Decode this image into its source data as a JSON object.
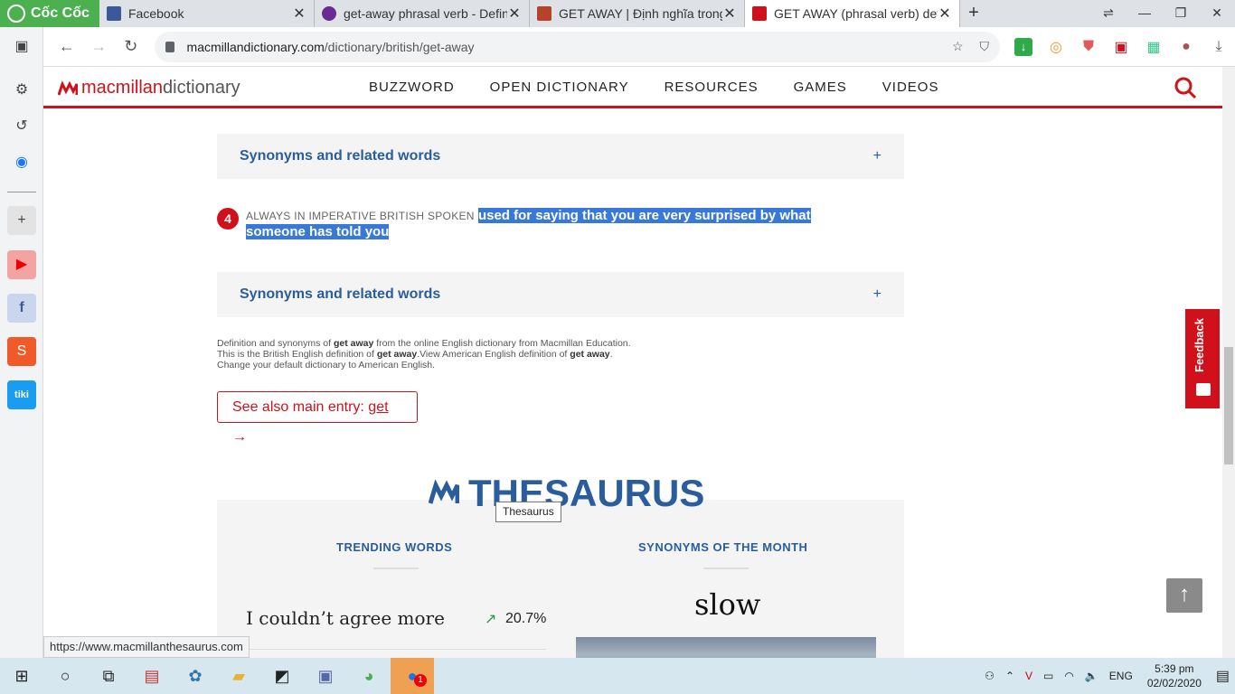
{
  "browser": {
    "brand": "Cốc Cốc",
    "tabs": [
      {
        "title": "Facebook",
        "color": "#3b5998"
      },
      {
        "title": "get-away phrasal verb - Defin",
        "color": "#6a2c91"
      },
      {
        "title": "GET AWAY | Định nghĩa trong",
        "color": "#b5432b"
      },
      {
        "title": "GET AWAY (phrasal verb) defi",
        "color": "#d0111c",
        "active": true
      }
    ],
    "url_host": "macmillandictionary.com",
    "url_path": "/dictionary/british/get-away",
    "status_url": "https://www.macmillanthesaurus.com"
  },
  "site": {
    "logo_brand": "macmillan",
    "logo_dict": "dictionary",
    "nav": [
      "BUZZWORD",
      "OPEN DICTIONARY",
      "RESOURCES",
      "GAMES",
      "VIDEOS"
    ]
  },
  "entry": {
    "synonyms_label": "Synonyms and related words",
    "expand_symbol": "+",
    "sense_number": "4",
    "sense_labels": "ALWAYS IN IMPERATIVE BRITISH SPOKEN",
    "sense_definition": "used for saying that you are very surprised by what someone has told you",
    "credit_line1_a": "Definition and synonyms of ",
    "credit_word": "get away",
    "credit_line1_b": " from the online English dictionary from Macmillan Education.",
    "credit_line2_a": "This is the British English definition of ",
    "credit_line2_b": ".View American English definition of ",
    "credit_line3": "Change your default dictionary to American English.",
    "see_also_prefix": "See also main entry: ",
    "see_also_word": "get",
    "see_also_arrow": "→"
  },
  "thesaurus": {
    "title": "THESAURUS",
    "tooltip": "Thesaurus",
    "trending_heading": "TRENDING WORDS",
    "synonyms_heading": "SYNONYMS OF THE MONTH",
    "trending_phrase": "I couldn’t agree more",
    "trending_pct": "20.7%",
    "trend_arrow": "↗",
    "synonym_word": "slow"
  },
  "widgets": {
    "feedback": "Feedback",
    "to_top": "↑"
  },
  "taskbar": {
    "lang": "ENG",
    "time": "5:39 pm",
    "date": "02/02/2020",
    "notif_count": "1"
  },
  "colors": {
    "brand_red": "#d0111c",
    "link_blue": "#2a5d9c",
    "selection": "#3878d8"
  }
}
